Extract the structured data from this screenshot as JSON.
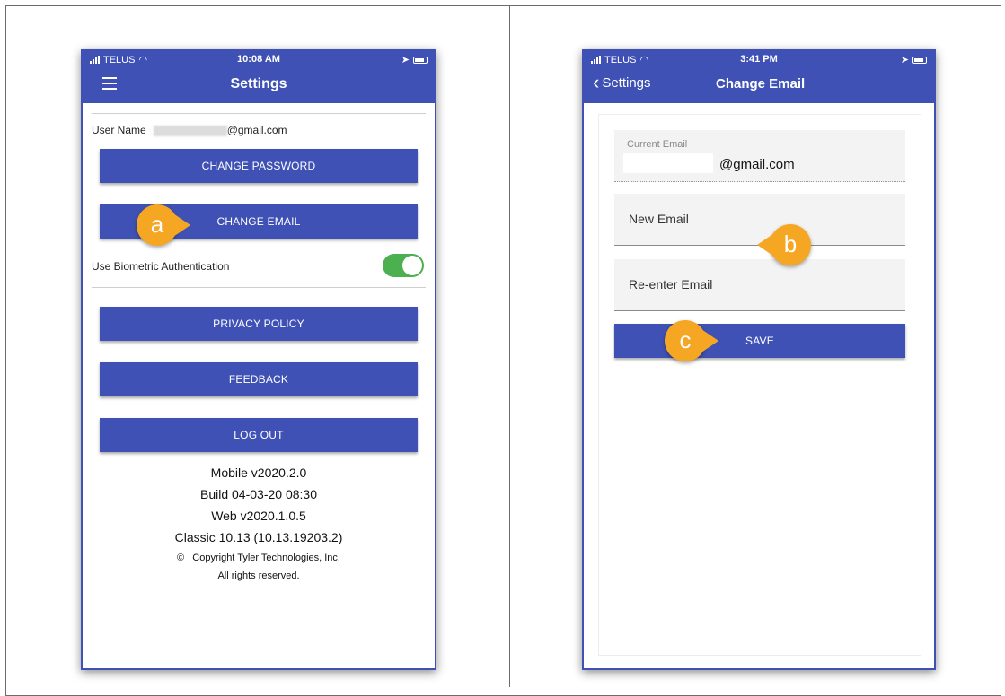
{
  "left_screen": {
    "status": {
      "carrier": "TELUS",
      "time": "10:08 AM"
    },
    "header_title": "Settings",
    "user_label": "User Name",
    "user_email_suffix": "@gmail.com",
    "buttons": {
      "change_password": "CHANGE PASSWORD",
      "change_email": "CHANGE EMAIL",
      "privacy_policy": "PRIVACY POLICY",
      "feedback": "FEEDBACK",
      "log_out": "LOG OUT"
    },
    "biometric_label": "Use Biometric Authentication",
    "biometric_enabled": true,
    "version": {
      "mobile": "Mobile v2020.2.0",
      "build": "Build 04-03-20 08:30",
      "web": "Web v2020.1.0.5",
      "classic": "Classic 10.13 (10.13.19203.2)",
      "copyright": "©   Copyright Tyler Technologies, Inc.",
      "rights": "All rights reserved."
    },
    "callout": "a"
  },
  "right_screen": {
    "status": {
      "carrier": "TELUS",
      "time": "3:41 PM"
    },
    "back_label": "Settings",
    "header_title": "Change Email",
    "current_email_label": "Current Email",
    "current_email_suffix": "@gmail.com",
    "new_email_placeholder": "New Email",
    "reenter_email_placeholder": "Re-enter Email",
    "save_label": "SAVE",
    "callouts": {
      "b": "b",
      "c": "c"
    }
  },
  "colors": {
    "brand": "#3f51b5",
    "toggle": "#4caf50",
    "callout": "#f5a623"
  }
}
